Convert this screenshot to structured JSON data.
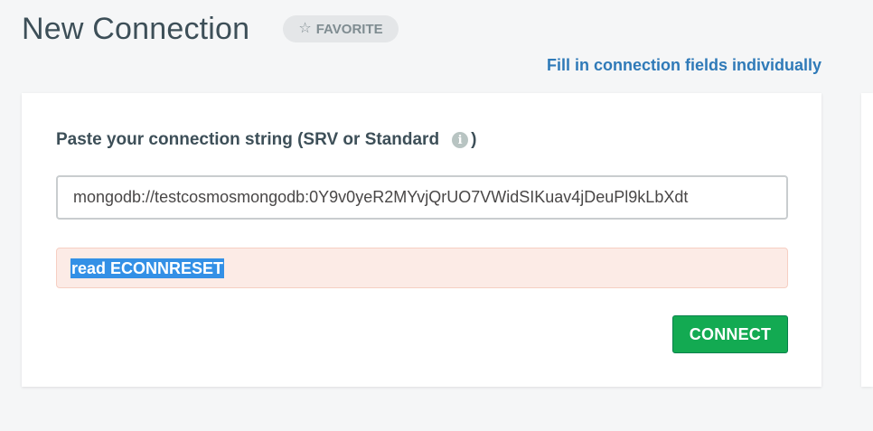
{
  "header": {
    "title": "New Connection",
    "favorite_label": "FAVORITE",
    "favorite_icon": "star-outline-icon"
  },
  "links": {
    "fill_individually": "Fill in connection fields individually"
  },
  "form": {
    "label": "Paste your connection string (SRV or Standard",
    "label_close": ")",
    "info_icon": "info-icon",
    "connection_string_value": "mongodb://testcosmosmongodb:0Y9v0yeR2MYvjQrUO7VWidSIKuav4jDeuPl9kLbXdt",
    "error_message": "read ECONNRESET",
    "connect_label": "CONNECT"
  },
  "colors": {
    "accent_link": "#2f7ab8",
    "connect_button": "#13aa52",
    "error_background": "#fcebe6",
    "selection_highlight": "#3390e6"
  }
}
